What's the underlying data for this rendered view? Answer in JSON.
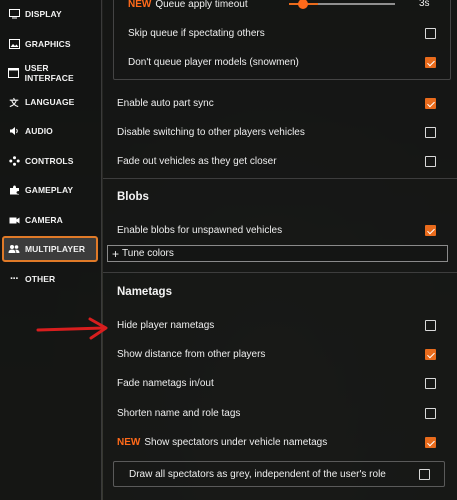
{
  "sidebar": {
    "items": [
      {
        "label": "DISPLAY",
        "icon": "monitor-icon",
        "active": false
      },
      {
        "label": "GRAPHICS",
        "icon": "image-icon",
        "active": false
      },
      {
        "label": "USER INTERFACE",
        "icon": "window-icon",
        "active": false
      },
      {
        "label": "LANGUAGE",
        "icon": "translate-icon",
        "active": false
      },
      {
        "label": "AUDIO",
        "icon": "speaker-icon",
        "active": false
      },
      {
        "label": "CONTROLS",
        "icon": "gamepad-icon",
        "active": false
      },
      {
        "label": "GAMEPLAY",
        "icon": "puzzle-icon",
        "active": false
      },
      {
        "label": "CAMERA",
        "icon": "camera-icon",
        "active": false
      },
      {
        "label": "MULTIPLAYER",
        "icon": "people-icon",
        "active": true
      },
      {
        "label": "OTHER",
        "icon": "more-icon",
        "active": false
      }
    ]
  },
  "queue": {
    "timeout": {
      "new_tag": "NEW",
      "label": "Queue apply timeout",
      "value": "3s",
      "slider_fraction": 0.15
    },
    "skip_spectating": {
      "label": "Skip queue if spectating others",
      "checked": false
    },
    "dont_queue_models": {
      "label": "Don't queue player models (snowmen)",
      "checked": true
    }
  },
  "vehicles": {
    "auto_part_sync": {
      "label": "Enable auto part sync",
      "checked": true
    },
    "disable_switching": {
      "label": "Disable switching to other players vehicles",
      "checked": false
    },
    "fade_vehicles": {
      "label": "Fade out vehicles as they get closer",
      "checked": false
    }
  },
  "blobs": {
    "title": "Blobs",
    "enable_blobs": {
      "label": "Enable blobs for unspawned vehicles",
      "checked": true
    },
    "tune_colors": {
      "plus": "+",
      "label": "Tune colors"
    }
  },
  "nametags": {
    "title": "Nametags",
    "hide_nametags": {
      "label": "Hide player nametags",
      "checked": false
    },
    "show_distance": {
      "label": "Show distance from other players",
      "checked": true
    },
    "fade_nametags": {
      "label": "Fade nametags in/out",
      "checked": false
    },
    "shorten_tags": {
      "label": "Shorten name and role tags",
      "checked": false
    },
    "show_spectators": {
      "new_tag": "NEW",
      "label": "Show spectators under vehicle nametags",
      "checked": true
    },
    "grey_spectators": {
      "label": "Draw all spectators as grey, independent of the user's role",
      "checked": false
    }
  },
  "colors": {
    "accent": "#e96b1c",
    "annotation_arrow": "#d81e1e"
  }
}
